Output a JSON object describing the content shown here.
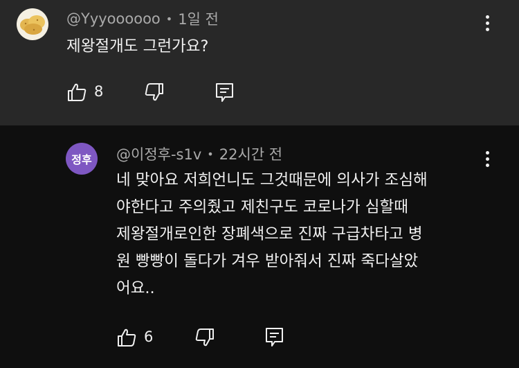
{
  "comments": [
    {
      "avatar_icon": "potato-icon",
      "author": "@Yyyoooooo",
      "separator": "•",
      "time": "1일 전",
      "lines": [
        "제왕절개도 그런가요?"
      ],
      "likes": "8"
    },
    {
      "avatar_text": "정후",
      "author": "@이정후-s1v",
      "separator": "•",
      "time": "22시간 전",
      "lines": [
        "네 맞아요 저희언니도 그것때문에 의사가 조심해",
        "야한다고 주의줬고 제친구도  코로나가 심할때",
        "제왕절개로인한 장폐색으로 진짜 구급차타고 병",
        "원 빵빵이 돌다가 겨우 받아줘서 진짜 죽다살았",
        "어요.."
      ],
      "likes": "6"
    }
  ],
  "colors": {
    "top_bg": "#282828",
    "bottom_bg": "#0f0f0f",
    "avatar_purple": "#7e57c2",
    "meta_gray": "#aaaaaa"
  }
}
